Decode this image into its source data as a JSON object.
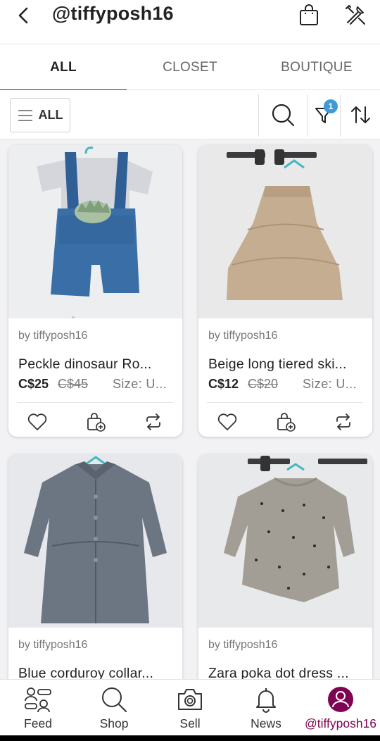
{
  "header": {
    "title": "@tiffyposh16",
    "icons": [
      "back-icon",
      "shopping-bag-icon",
      "tools-icon"
    ]
  },
  "tabs": [
    {
      "label": "ALL",
      "active": true
    },
    {
      "label": "CLOSET",
      "active": false
    },
    {
      "label": "BOUTIQUE",
      "active": false
    }
  ],
  "toolbar": {
    "all_label": "ALL",
    "filter_badge": "1"
  },
  "listings": [
    {
      "by": "by tiffyposh16",
      "title": "Peckle dinosaur Ro...",
      "price": "C$25",
      "original_price": "C$45",
      "size": "Size: U..."
    },
    {
      "by": "by tiffyposh16",
      "title": "Beige long tiered ski...",
      "price": "C$12",
      "original_price": "C$20",
      "size": "Size: U..."
    },
    {
      "by": "by tiffyposh16",
      "title": "Blue corduroy collar..."
    },
    {
      "by": "by tiffyposh16",
      "title": "Zara poka dot dress ..."
    }
  ],
  "nav": [
    {
      "label": "Feed",
      "icon": "feed-icon"
    },
    {
      "label": "Shop",
      "icon": "search-icon"
    },
    {
      "label": "Sell",
      "icon": "camera-icon"
    },
    {
      "label": "News",
      "icon": "bell-icon"
    },
    {
      "label": "@tiffyposh16",
      "icon": "profile-icon",
      "active": true
    }
  ],
  "colors": {
    "accent": "#7f0353",
    "badge": "#3f9ad8"
  }
}
